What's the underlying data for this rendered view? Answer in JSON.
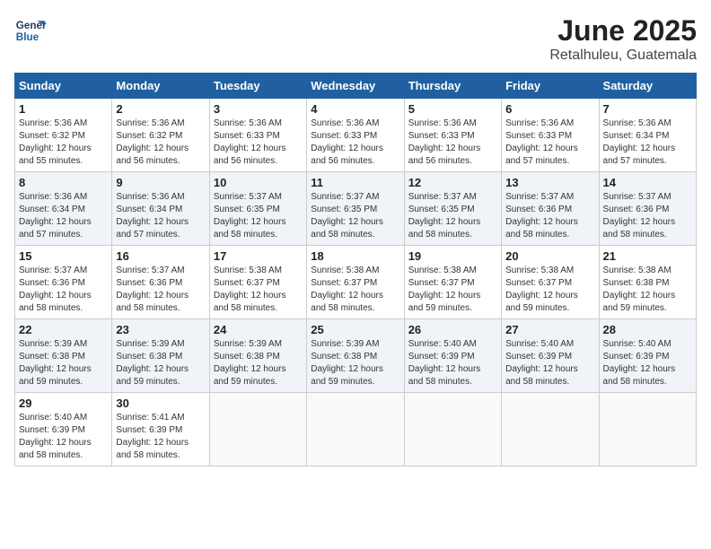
{
  "header": {
    "logo_line1": "General",
    "logo_line2": "Blue",
    "title": "June 2025",
    "subtitle": "Retalhuleu, Guatemala"
  },
  "weekdays": [
    "Sunday",
    "Monday",
    "Tuesday",
    "Wednesday",
    "Thursday",
    "Friday",
    "Saturday"
  ],
  "weeks": [
    [
      {
        "day": "1",
        "sunrise": "5:36 AM",
        "sunset": "6:32 PM",
        "daylight": "12 hours and 55 minutes."
      },
      {
        "day": "2",
        "sunrise": "5:36 AM",
        "sunset": "6:32 PM",
        "daylight": "12 hours and 56 minutes."
      },
      {
        "day": "3",
        "sunrise": "5:36 AM",
        "sunset": "6:33 PM",
        "daylight": "12 hours and 56 minutes."
      },
      {
        "day": "4",
        "sunrise": "5:36 AM",
        "sunset": "6:33 PM",
        "daylight": "12 hours and 56 minutes."
      },
      {
        "day": "5",
        "sunrise": "5:36 AM",
        "sunset": "6:33 PM",
        "daylight": "12 hours and 56 minutes."
      },
      {
        "day": "6",
        "sunrise": "5:36 AM",
        "sunset": "6:33 PM",
        "daylight": "12 hours and 57 minutes."
      },
      {
        "day": "7",
        "sunrise": "5:36 AM",
        "sunset": "6:34 PM",
        "daylight": "12 hours and 57 minutes."
      }
    ],
    [
      {
        "day": "8",
        "sunrise": "5:36 AM",
        "sunset": "6:34 PM",
        "daylight": "12 hours and 57 minutes."
      },
      {
        "day": "9",
        "sunrise": "5:36 AM",
        "sunset": "6:34 PM",
        "daylight": "12 hours and 57 minutes."
      },
      {
        "day": "10",
        "sunrise": "5:37 AM",
        "sunset": "6:35 PM",
        "daylight": "12 hours and 58 minutes."
      },
      {
        "day": "11",
        "sunrise": "5:37 AM",
        "sunset": "6:35 PM",
        "daylight": "12 hours and 58 minutes."
      },
      {
        "day": "12",
        "sunrise": "5:37 AM",
        "sunset": "6:35 PM",
        "daylight": "12 hours and 58 minutes."
      },
      {
        "day": "13",
        "sunrise": "5:37 AM",
        "sunset": "6:36 PM",
        "daylight": "12 hours and 58 minutes."
      },
      {
        "day": "14",
        "sunrise": "5:37 AM",
        "sunset": "6:36 PM",
        "daylight": "12 hours and 58 minutes."
      }
    ],
    [
      {
        "day": "15",
        "sunrise": "5:37 AM",
        "sunset": "6:36 PM",
        "daylight": "12 hours and 58 minutes."
      },
      {
        "day": "16",
        "sunrise": "5:37 AM",
        "sunset": "6:36 PM",
        "daylight": "12 hours and 58 minutes."
      },
      {
        "day": "17",
        "sunrise": "5:38 AM",
        "sunset": "6:37 PM",
        "daylight": "12 hours and 58 minutes."
      },
      {
        "day": "18",
        "sunrise": "5:38 AM",
        "sunset": "6:37 PM",
        "daylight": "12 hours and 58 minutes."
      },
      {
        "day": "19",
        "sunrise": "5:38 AM",
        "sunset": "6:37 PM",
        "daylight": "12 hours and 59 minutes."
      },
      {
        "day": "20",
        "sunrise": "5:38 AM",
        "sunset": "6:37 PM",
        "daylight": "12 hours and 59 minutes."
      },
      {
        "day": "21",
        "sunrise": "5:38 AM",
        "sunset": "6:38 PM",
        "daylight": "12 hours and 59 minutes."
      }
    ],
    [
      {
        "day": "22",
        "sunrise": "5:39 AM",
        "sunset": "6:38 PM",
        "daylight": "12 hours and 59 minutes."
      },
      {
        "day": "23",
        "sunrise": "5:39 AM",
        "sunset": "6:38 PM",
        "daylight": "12 hours and 59 minutes."
      },
      {
        "day": "24",
        "sunrise": "5:39 AM",
        "sunset": "6:38 PM",
        "daylight": "12 hours and 59 minutes."
      },
      {
        "day": "25",
        "sunrise": "5:39 AM",
        "sunset": "6:38 PM",
        "daylight": "12 hours and 59 minutes."
      },
      {
        "day": "26",
        "sunrise": "5:40 AM",
        "sunset": "6:39 PM",
        "daylight": "12 hours and 58 minutes."
      },
      {
        "day": "27",
        "sunrise": "5:40 AM",
        "sunset": "6:39 PM",
        "daylight": "12 hours and 58 minutes."
      },
      {
        "day": "28",
        "sunrise": "5:40 AM",
        "sunset": "6:39 PM",
        "daylight": "12 hours and 58 minutes."
      }
    ],
    [
      {
        "day": "29",
        "sunrise": "5:40 AM",
        "sunset": "6:39 PM",
        "daylight": "12 hours and 58 minutes."
      },
      {
        "day": "30",
        "sunrise": "5:41 AM",
        "sunset": "6:39 PM",
        "daylight": "12 hours and 58 minutes."
      },
      null,
      null,
      null,
      null,
      null
    ]
  ]
}
